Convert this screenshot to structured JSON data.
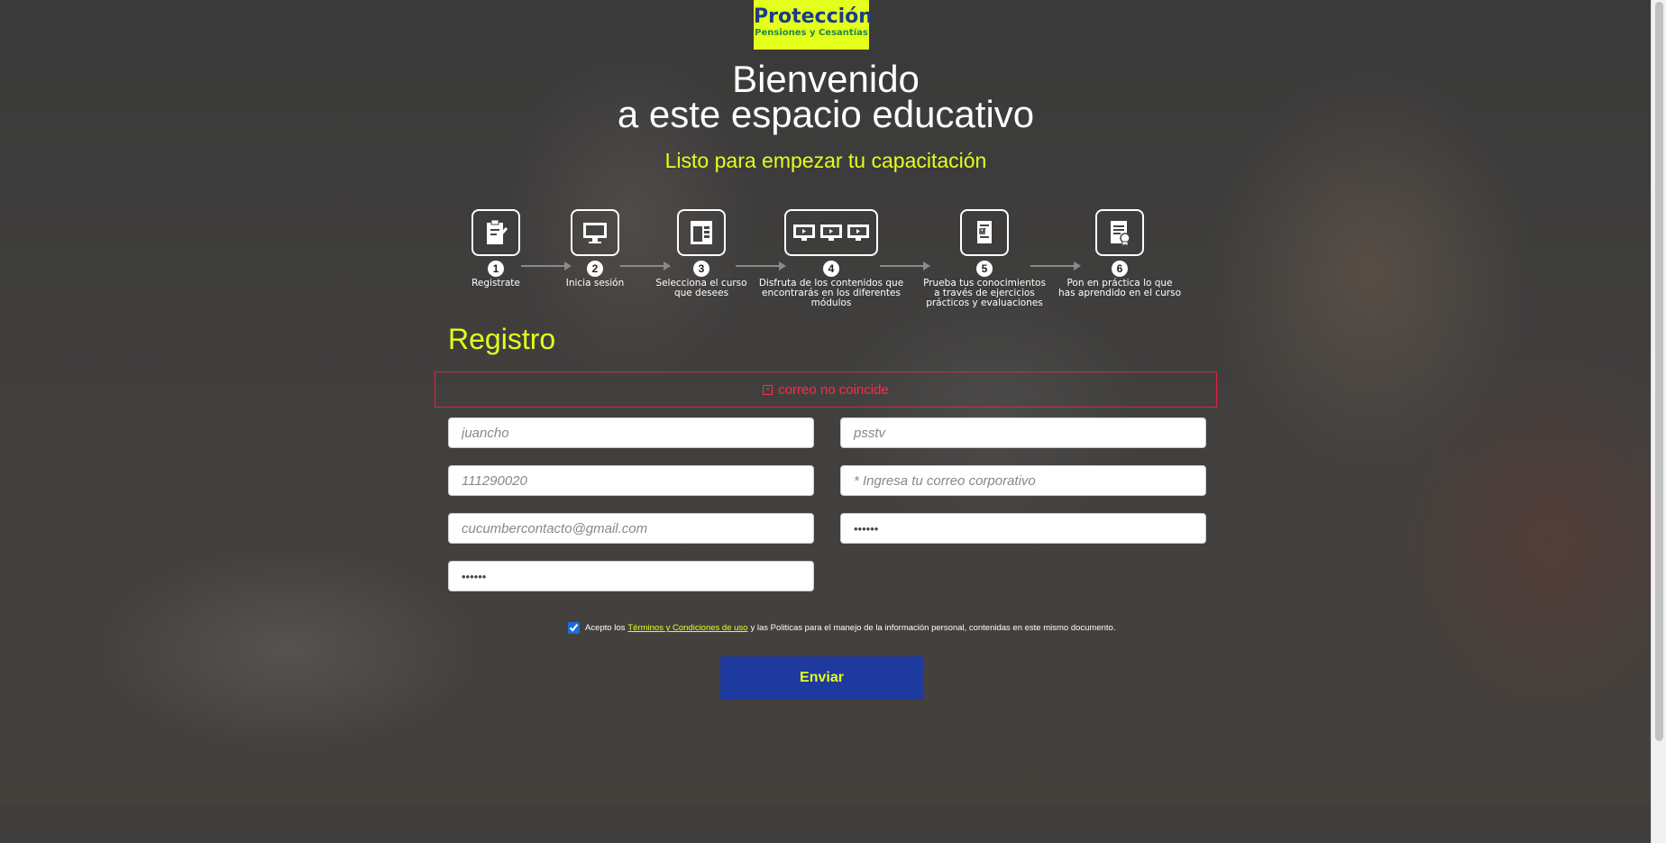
{
  "brand": {
    "name": "Protección",
    "tagline": "Pensiones y Cesantías"
  },
  "hero": {
    "title_line1": "Bienvenido",
    "title_line2": "a este espacio educativo",
    "subtitle": "Listo para empezar tu capacitación"
  },
  "steps": [
    {
      "num": "1",
      "label": "Registrate",
      "icon": "clipboard-pencil-icon"
    },
    {
      "num": "2",
      "label": "Inicia sesión",
      "icon": "monitor-icon"
    },
    {
      "num": "3",
      "label": "Selecciona el curso\nque desees",
      "icon": "browser-window-icon"
    },
    {
      "num": "4",
      "label": "Disfruta de los contenidos que\nencontrarás en los diferentes módulos",
      "icon": "multiple-monitors-icon"
    },
    {
      "num": "5",
      "label": "Prueba tus conocimientos\na través de ejercicios\nprácticos y evaluaciones",
      "icon": "checklist-icon"
    },
    {
      "num": "6",
      "label": "Pon en práctica lo que\nhas aprendido en el curso",
      "icon": "certificate-icon"
    }
  ],
  "form": {
    "heading": "Registro",
    "error": "correo no coincide",
    "first_name": {
      "value": "",
      "placeholder": "juancho"
    },
    "last_name": {
      "value": "",
      "placeholder": "psstv"
    },
    "document": {
      "value": "",
      "placeholder": "111290020"
    },
    "corporate_email": {
      "value": "",
      "placeholder": "* Ingresa tu correo corporativo"
    },
    "personal_email": {
      "value": "",
      "placeholder": "cucumbercontacto@gmail.com"
    },
    "password": {
      "value": "••••••"
    },
    "password_confirm": {
      "value": "••••••"
    },
    "terms_prefix": "Acepto los",
    "terms_link": "Términos y Condiciones de uso",
    "terms_suffix": "y las Politicas para el manejo de la información personal, contenidas en este mismo documento.",
    "submit": "Enviar"
  },
  "colors": {
    "accent": "#e4ff1a",
    "button": "#1f3a9e",
    "error": "#e0233f"
  }
}
